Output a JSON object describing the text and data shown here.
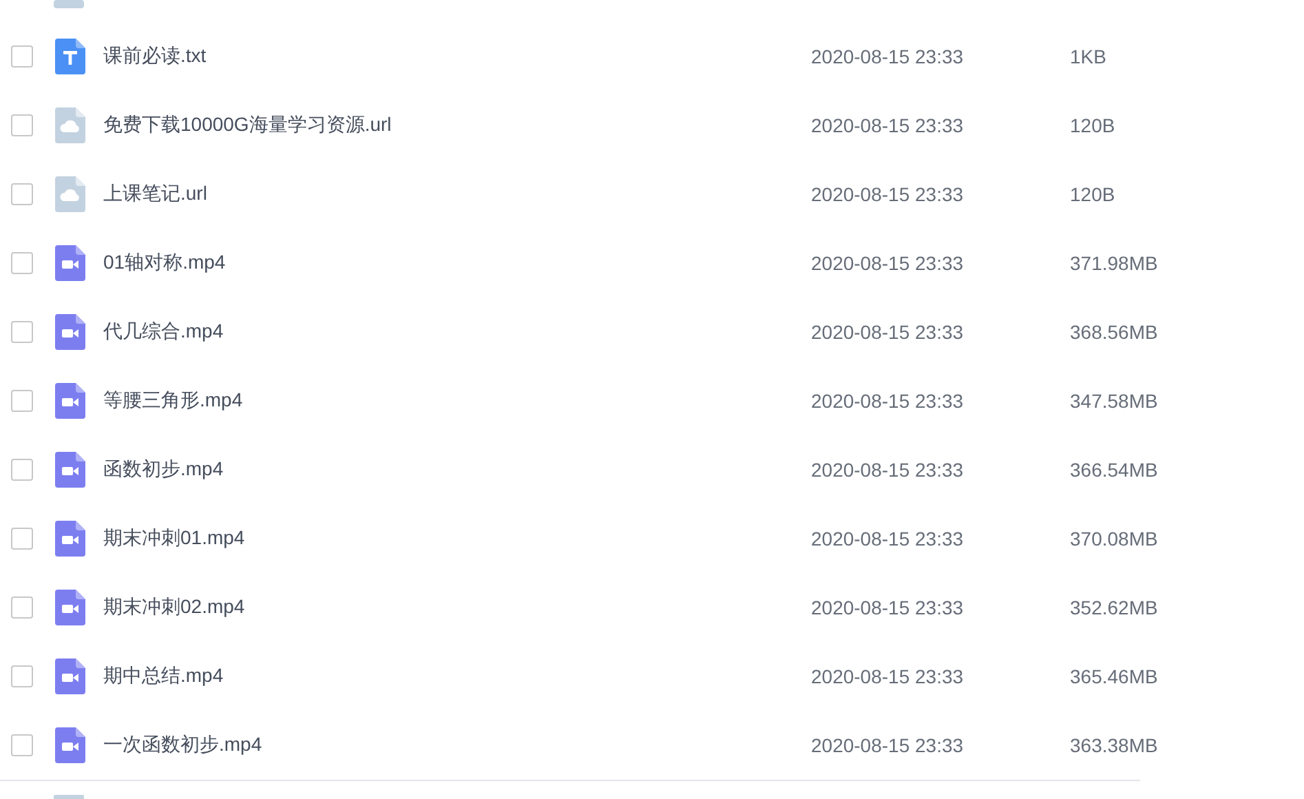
{
  "files": [
    {
      "kind": "text",
      "name": "课前必读.txt",
      "modified": "2020-08-15 23:33",
      "size": "1KB",
      "checked": false
    },
    {
      "kind": "link",
      "name": "免费下载10000G海量学习资源.url",
      "modified": "2020-08-15 23:33",
      "size": "120B",
      "checked": false
    },
    {
      "kind": "link",
      "name": "上课笔记.url",
      "modified": "2020-08-15 23:33",
      "size": "120B",
      "checked": false
    },
    {
      "kind": "video",
      "name": "01轴对称.mp4",
      "modified": "2020-08-15 23:33",
      "size": "371.98MB",
      "checked": false
    },
    {
      "kind": "video",
      "name": "代几综合.mp4",
      "modified": "2020-08-15 23:33",
      "size": "368.56MB",
      "checked": false
    },
    {
      "kind": "video",
      "name": "等腰三角形.mp4",
      "modified": "2020-08-15 23:33",
      "size": "347.58MB",
      "checked": false
    },
    {
      "kind": "video",
      "name": "函数初步.mp4",
      "modified": "2020-08-15 23:33",
      "size": "366.54MB",
      "checked": false
    },
    {
      "kind": "video",
      "name": "期末冲刺01.mp4",
      "modified": "2020-08-15 23:33",
      "size": "370.08MB",
      "checked": false
    },
    {
      "kind": "video",
      "name": "期末冲刺02.mp4",
      "modified": "2020-08-15 23:33",
      "size": "352.62MB",
      "checked": false
    },
    {
      "kind": "video",
      "name": "期中总结.mp4",
      "modified": "2020-08-15 23:33",
      "size": "365.46MB",
      "checked": false
    },
    {
      "kind": "video",
      "name": "一次函数初步.mp4",
      "modified": "2020-08-15 23:33",
      "size": "363.38MB",
      "checked": false
    }
  ]
}
